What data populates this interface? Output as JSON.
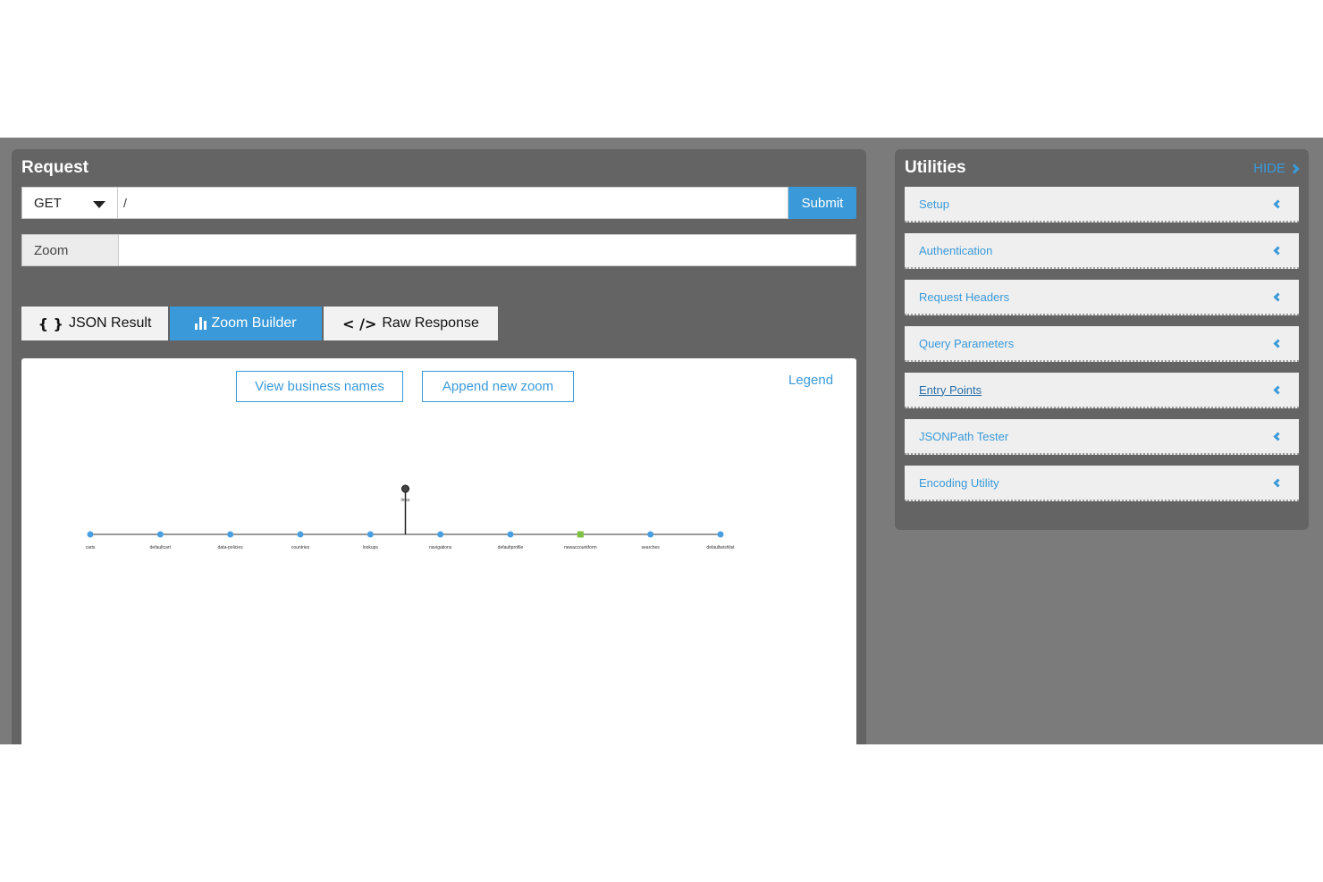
{
  "request": {
    "title": "Request",
    "method": "GET",
    "url": "/",
    "submit_label": "Submit",
    "zoom_label": "Zoom",
    "zoom_value": ""
  },
  "tabs": [
    {
      "icon": "{ }",
      "label": "JSON Result",
      "active": false
    },
    {
      "icon": "bar-chart-icon",
      "label": "Zoom Builder",
      "active": true
    },
    {
      "icon": "< />",
      "label": "Raw Response",
      "active": false
    }
  ],
  "builder": {
    "view_business_names_label": "View business names",
    "append_zoom_label": "Append new zoom",
    "legend_label": "Legend",
    "root_label": "links",
    "nodes": [
      "carts",
      "defaultcart",
      "data-policies",
      "countries",
      "lookups",
      "navigations",
      "defaultprofile",
      "newaccountform",
      "searches",
      "defaultwishlist"
    ],
    "highlighted_node": "newaccountform",
    "node_color": "#4a9fe0",
    "highlight_color": "#7dc242"
  },
  "utilities": {
    "title": "Utilities",
    "hide_label": "HIDE",
    "items": [
      {
        "label": "Setup"
      },
      {
        "label": "Authentication"
      },
      {
        "label": "Request Headers"
      },
      {
        "label": "Query Parameters"
      },
      {
        "label": "Entry Points",
        "hovered": true
      },
      {
        "label": "JSONPath Tester"
      },
      {
        "label": "Encoding Utility"
      }
    ]
  },
  "colors": {
    "accent": "#3a9ad9",
    "panel": "#646464",
    "background": "#7b7b7b"
  }
}
